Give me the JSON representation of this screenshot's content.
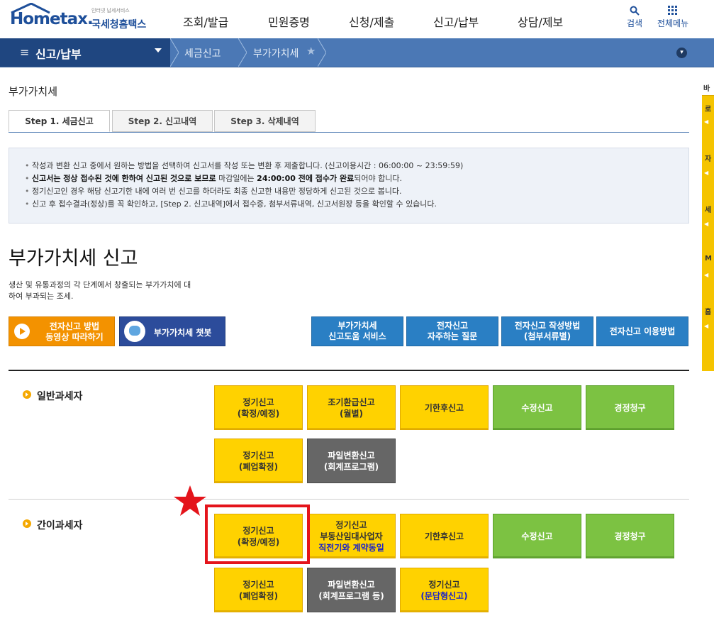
{
  "header": {
    "logo_small": "인터넷 납세서비스",
    "logo_main": "Hometax.",
    "logo_sub": "국세청홈택스",
    "gnb": [
      "조회/발급",
      "민원증명",
      "신청/제출",
      "신고/납부",
      "상담/제보"
    ],
    "tools": [
      {
        "label": "검색",
        "icon": "search-icon"
      },
      {
        "label": "전체메뉴",
        "icon": "grid-icon"
      }
    ]
  },
  "nav": {
    "section": "신고/납부",
    "crumbs": [
      "세금신고",
      "부가가치세"
    ]
  },
  "side": {
    "top": "바",
    "items": [
      "로",
      "자",
      "세",
      "M",
      "홈"
    ]
  },
  "page": {
    "title": "부가가치세",
    "tabs": [
      "Step 1. 세금신고",
      "Step 2. 신고내역",
      "Step 3. 삭제내역"
    ],
    "notice": [
      "작성과 변환 신고 중에서 원하는 방법을 선택하여 신고서를 작성 또는 변환 후 제출합니다. (신고이용시간 : 06:00:00 ~ 23:59:59)",
      {
        "strong": "신고서는 정상 접수된 것에 한하여 신고된 것으로 보므로",
        "mid": " 마감일에는 ",
        "strong2": "24:00:00 전에 접수가 완료",
        "tail": "되어야 합니다."
      },
      "정기신고인 경우 해당 신고기한 내에 여러 번 신고를 하더라도 최종 신고한 내용만 정당하게 신고된 것으로 봅니다.",
      "신고 후 접수결과(정상)를 꼭 확인하고, [Step 2. 신고내역]에서 접수증, 첨부서류내역, 신고서원장 등을 확인할 수 있습니다."
    ],
    "heading": "부가가치세 신고",
    "desc": "생산 및 유통과정의 각 단계에서 창출되는 부가가치에 대하여 부과되는 조세."
  },
  "buttons": {
    "video": [
      "전자신고 방법",
      "동영상 따라하기"
    ],
    "chatbot": "부가가치세 챗봇",
    "blue": [
      [
        "부가가치세",
        "신고도움 서비스"
      ],
      [
        "전자신고",
        "자주하는 질문"
      ],
      [
        "전자신고 작성방법",
        "(첨부서류별)"
      ],
      [
        "전자신고 이용방법"
      ]
    ]
  },
  "general": {
    "label": "일반과세자",
    "row1": [
      {
        "l1": "정기신고",
        "l2": "(확정/예정)",
        "c": "y"
      },
      {
        "l1": "조기환급신고",
        "l2": "(월별)",
        "c": "y"
      },
      {
        "l1": "기한후신고",
        "l2": "",
        "c": "y"
      },
      {
        "l1": "수정신고",
        "l2": "",
        "c": "g"
      },
      {
        "l1": "경정청구",
        "l2": "",
        "c": "g"
      }
    ],
    "row2": [
      {
        "l1": "정기신고",
        "l2": "(폐업확정)",
        "c": "y"
      },
      {
        "l1": "파일변환신고",
        "l2": "(회계프로그램)",
        "c": "d"
      }
    ]
  },
  "simple": {
    "label": "간이과세자",
    "row1": [
      {
        "l1": "정기신고",
        "l2": "(확정/예정)",
        "c": "y"
      },
      {
        "l1": "정기신고",
        "l2": "부동산임대사업자",
        "l3": "직전기와 계약동일",
        "c": "y"
      },
      {
        "l1": "기한후신고",
        "l2": "",
        "c": "y"
      },
      {
        "l1": "수정신고",
        "l2": "",
        "c": "g"
      },
      {
        "l1": "경정청구",
        "l2": "",
        "c": "g"
      }
    ],
    "row2": [
      {
        "l1": "정기신고",
        "l2": "(폐업확정)",
        "c": "y"
      },
      {
        "l1": "파일변환신고",
        "l2": "(회계프로그램 등)",
        "c": "d"
      },
      {
        "l1": "정기신고",
        "l2": "(문답형신고)",
        "c": "y",
        "blue": true
      }
    ]
  },
  "colors": {
    "accent": "#4b78b5",
    "nav_dark": "#1f4680",
    "yellow": "#ffd200",
    "green": "#7cc242",
    "highlight": "#e4141b"
  }
}
